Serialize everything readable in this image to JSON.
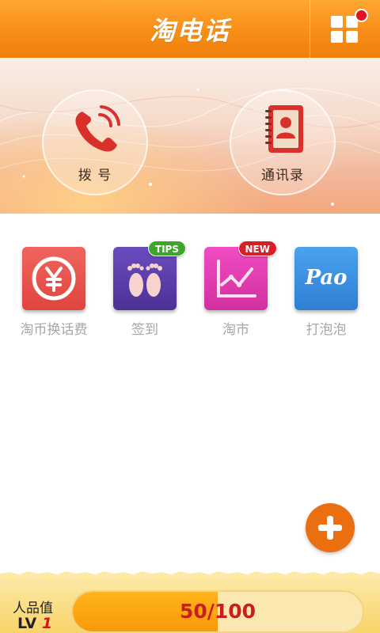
{
  "header": {
    "title": "淘电话",
    "menu_icon": "grid-icon",
    "has_notification": true
  },
  "banner": {
    "dial": {
      "label": "拨 号",
      "icon": "phone-icon"
    },
    "contacts": {
      "label": "通讯录",
      "icon": "contact-book-icon"
    }
  },
  "shortcuts": [
    {
      "label": "淘币换话费",
      "icon": "yen-coin-icon",
      "color": "#e8514b"
    },
    {
      "label": "签到",
      "icon": "footprints-icon",
      "color": "#5a3ea6",
      "badge": "TIPS",
      "badge_color": "#3fa62b"
    },
    {
      "label": "淘市",
      "icon": "trend-chart-icon",
      "color": "#e040b2",
      "badge": "NEW",
      "badge_color": "#d91f26"
    },
    {
      "label": "打泡泡",
      "icon": "pao-icon",
      "color": "#3a8fe0",
      "icon_text": "Pao"
    }
  ],
  "fab": {
    "icon": "plus-icon"
  },
  "level": {
    "title": "人品值",
    "prefix": "LV",
    "number": "1",
    "progress_text": "50/100",
    "progress_fraction": 0.5
  }
}
